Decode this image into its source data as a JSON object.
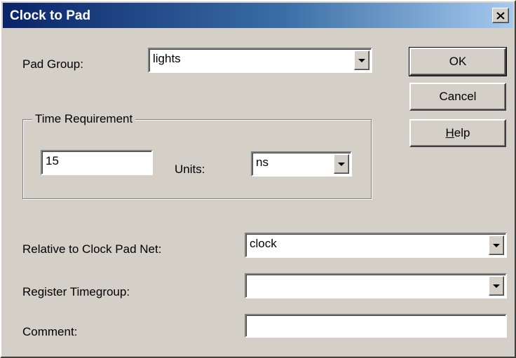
{
  "window": {
    "title": "Clock to Pad"
  },
  "pad_group": {
    "label": "Pad Group:",
    "value": "lights"
  },
  "time_requirement": {
    "group_label": "Time Requirement",
    "value": "15",
    "units_label": "Units:",
    "units_value": "ns"
  },
  "relative_clock": {
    "label": "Relative to Clock Pad Net:",
    "value": "clock"
  },
  "register_timegroup": {
    "label": "Register Timegroup:",
    "value": ""
  },
  "comment": {
    "label": "Comment:",
    "value": ""
  },
  "buttons": {
    "ok": "OK",
    "cancel": "Cancel",
    "help_mnemonic": "H",
    "help_rest": "elp"
  },
  "icons": {
    "close": "close-icon",
    "dropdown": "chevron-down-icon"
  },
  "colors": {
    "face": "#d4d0c8",
    "title_start": "#0a246a",
    "title_end": "#a6caf0",
    "field": "#ffffff"
  }
}
